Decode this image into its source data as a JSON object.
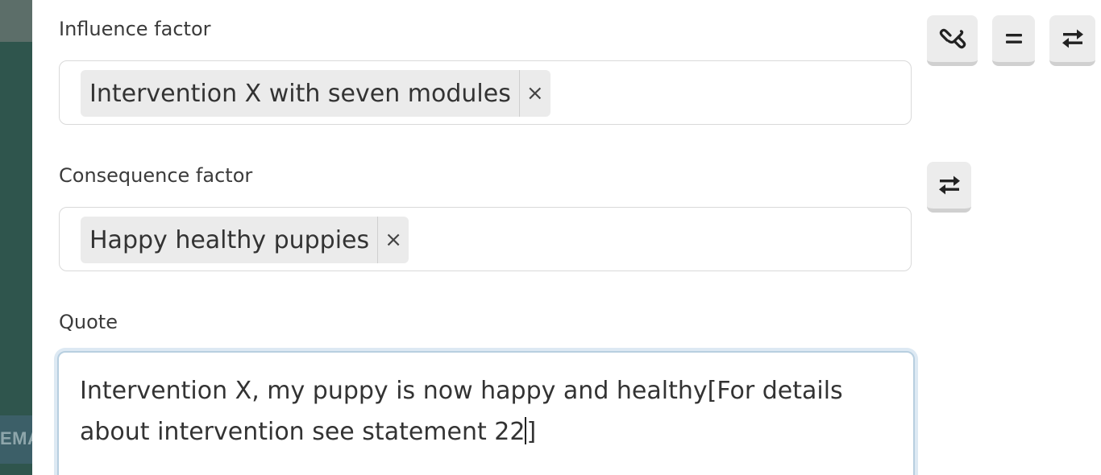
{
  "backdrop": {
    "badge_text": "EMA"
  },
  "influence": {
    "label": "Influence factor",
    "tag_text": "Intervention X with seven modules",
    "remove_glyph": "×"
  },
  "consequence": {
    "label": "Consequence factor",
    "tag_text": "Happy healthy puppies",
    "remove_glyph": "×"
  },
  "quote": {
    "label": "Quote",
    "text_before_caret": "Intervention X, my puppy is now happy and healthy[For details about intervention see statement 22",
    "text_after_caret": "]"
  },
  "toolbar": {
    "buttons": [
      {
        "icon": "link-icon",
        "glyph": "⛓"
      },
      {
        "icon": "equals-icon",
        "glyph": "="
      },
      {
        "icon": "swap-icon",
        "glyph": "⇄"
      }
    ],
    "consequence_swap": {
      "icon": "swap-icon",
      "glyph": "⇄"
    }
  },
  "colors": {
    "backdrop": "#2f554d",
    "focus_ring": "#dde9f3",
    "focus_border": "#b8cfe0",
    "tag_bg": "#ebebeb",
    "button_bg": "#ececec"
  }
}
